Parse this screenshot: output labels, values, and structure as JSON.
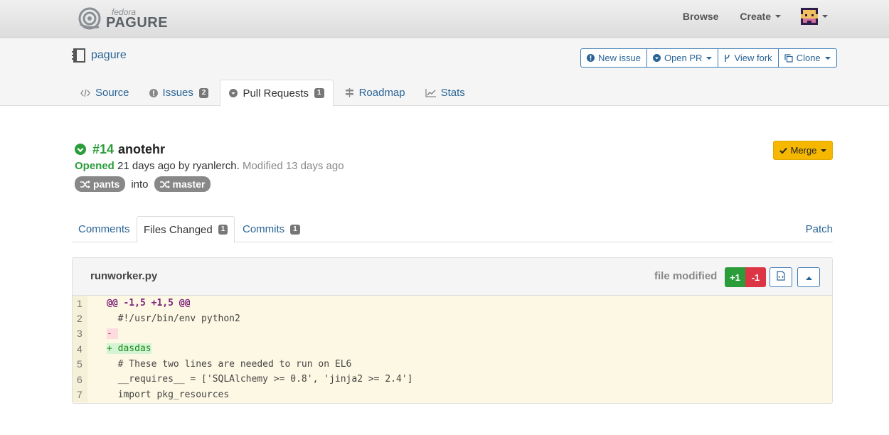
{
  "navbar": {
    "logo_small": "fedora",
    "logo_big": "PAGURE",
    "browse": "Browse",
    "create": "Create"
  },
  "repo": {
    "name": "pagure",
    "actions": {
      "new_issue": "New issue",
      "open_pr": "Open PR",
      "view_fork": "View fork",
      "clone": "Clone"
    },
    "tabs": [
      {
        "label": "Source",
        "icon": "code-icon"
      },
      {
        "label": "Issues",
        "icon": "exclamation-icon",
        "count": "2"
      },
      {
        "label": "Pull Requests",
        "icon": "pull-request-icon",
        "count": "1"
      },
      {
        "label": "Roadmap",
        "icon": "roadmap-icon"
      },
      {
        "label": "Stats",
        "icon": "chart-icon"
      }
    ]
  },
  "pr": {
    "number": "#14",
    "title": "anotehr",
    "status": "Opened",
    "opened_text": "21 days ago by ryanlerch.",
    "modified_text": "Modified 13 days ago",
    "from_branch": "pants",
    "into": "into",
    "to_branch": "master",
    "merge_label": "Merge"
  },
  "pr_tabs": {
    "comments": "Comments",
    "files_changed": "Files Changed",
    "files_changed_count": "1",
    "commits": "Commits",
    "commits_count": "1",
    "patch": "Patch"
  },
  "file": {
    "name": "runworker.py",
    "status": "file modified",
    "additions": "+1",
    "deletions": "-1",
    "lines": [
      {
        "n": "1",
        "text": "@@ -1,5 +1,5 @@",
        "kind": "hunk"
      },
      {
        "n": "2",
        "text": "  #!/usr/bin/env python2",
        "kind": "ctx"
      },
      {
        "n": "3",
        "text": "- ",
        "kind": "del"
      },
      {
        "n": "4",
        "text": "+ dasdas",
        "kind": "add"
      },
      {
        "n": "5",
        "text": "  # These two lines are needed to run on EL6",
        "kind": "ctx"
      },
      {
        "n": "6",
        "text": "  __requires__ = ['SQLAlchemy >= 0.8', 'jinja2 >= 2.4']",
        "kind": "ctx"
      },
      {
        "n": "7",
        "text": "  import pkg_resources",
        "kind": "ctx"
      }
    ]
  },
  "colors": {
    "link": "#2a6496",
    "success": "#2a9d3a",
    "danger": "#dc3545",
    "merge": "#f5b700",
    "diff_bg": "#fcf8e3"
  }
}
